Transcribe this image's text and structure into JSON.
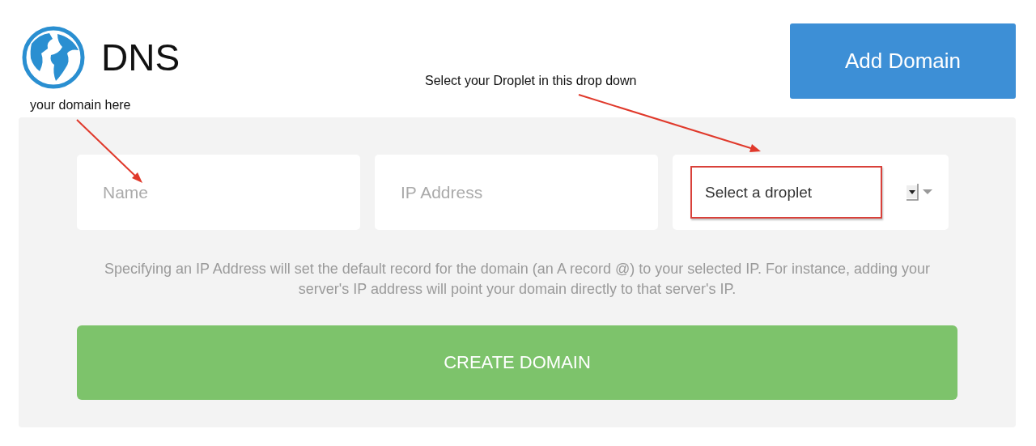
{
  "header": {
    "title": "DNS",
    "add_button": "Add Domain"
  },
  "annotations": [
    {
      "text": "your domain here"
    },
    {
      "text": "Select your Droplet in this drop down"
    }
  ],
  "form": {
    "name_field": {
      "placeholder": "Name"
    },
    "ip_field": {
      "placeholder": "IP Address"
    },
    "droplet_select": {
      "value": "Select a droplet",
      "highlighted": true
    },
    "help_text": "Specifying an IP Address will set the default record for the domain (an A record @) to your selected IP. For instance, adding your server's IP address will point your domain directly to that server's IP.",
    "submit": "CREATE DOMAIN"
  }
}
